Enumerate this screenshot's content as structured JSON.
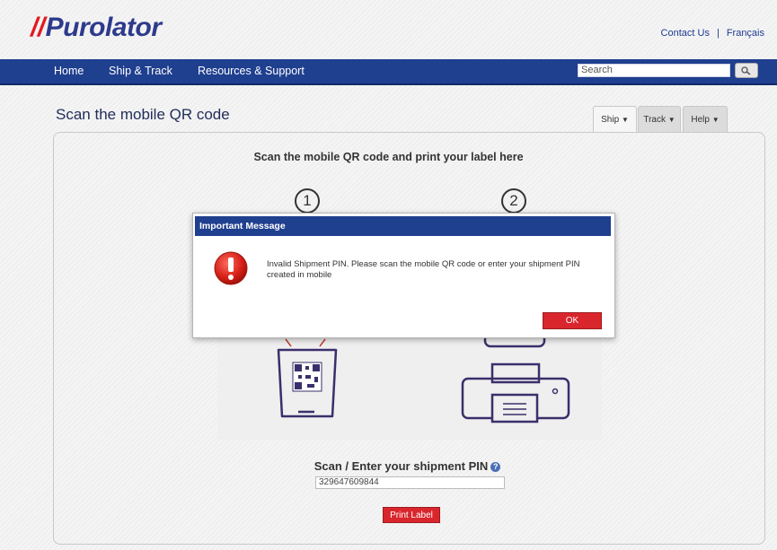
{
  "header": {
    "logo_text": "Purolator",
    "contact_link": "Contact Us",
    "separator": "|",
    "language_link": "Français"
  },
  "nav": {
    "items": [
      {
        "label": "Home"
      },
      {
        "label": "Ship & Track"
      },
      {
        "label": "Resources & Support"
      }
    ],
    "search_placeholder": "Search"
  },
  "page": {
    "title": "Scan the mobile QR code",
    "tabs": [
      {
        "label": "Ship"
      },
      {
        "label": "Track"
      },
      {
        "label": "Help"
      }
    ],
    "heading": "Scan the mobile QR code and print your label here",
    "steps": [
      "1",
      "2"
    ],
    "pin_label": "Scan / Enter your shipment PIN",
    "pin_value": "329647609844",
    "print_button": "Print Label"
  },
  "dialog": {
    "title": "Important Message",
    "message": "Invalid Shipment PIN. Please scan the mobile QR code or enter your shipment PIN created in mobile",
    "ok_button": "OK"
  },
  "colors": {
    "brand_blue": "#1f3f8f",
    "brand_red": "#d9262c"
  }
}
